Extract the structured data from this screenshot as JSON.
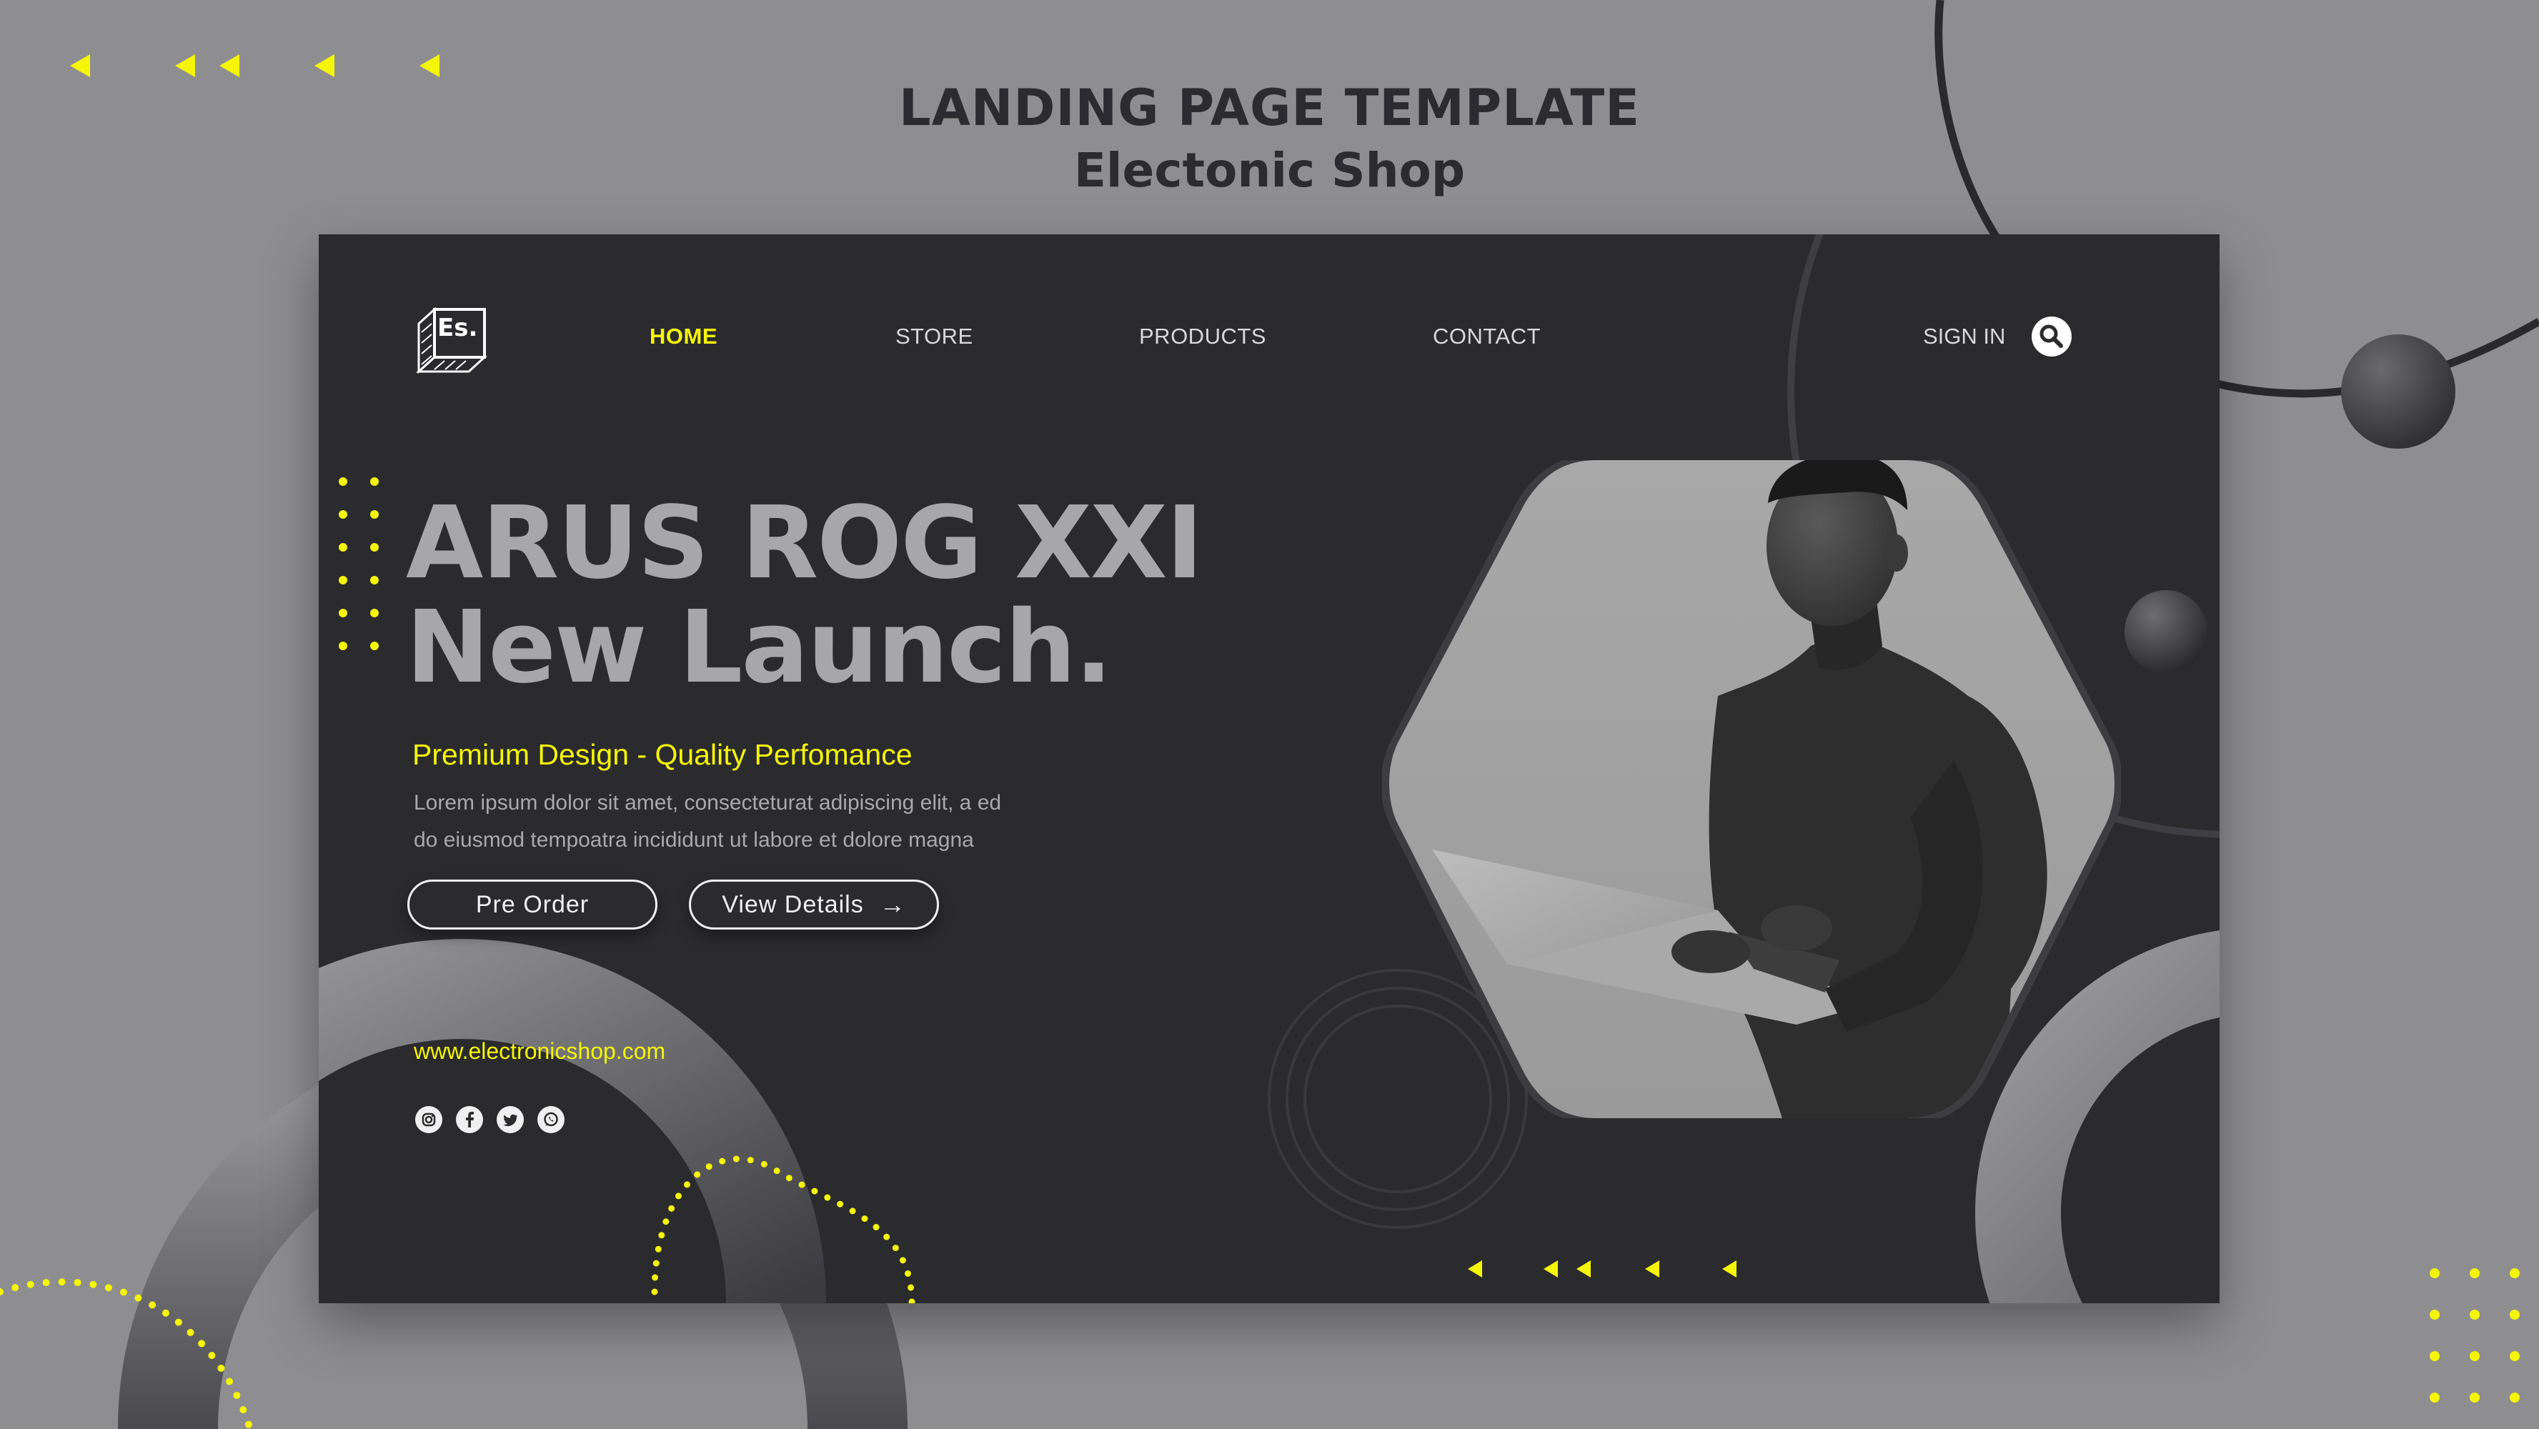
{
  "page": {
    "title": "LANDING PAGE TEMPLATE",
    "subtitle": "Electonic Shop"
  },
  "header": {
    "logo_text": "Es.",
    "nav": [
      {
        "label": "HOME",
        "active": true
      },
      {
        "label": "STORE",
        "active": false
      },
      {
        "label": "PRODUCTS",
        "active": false
      },
      {
        "label": "CONTACT",
        "active": false
      }
    ],
    "sign_in": "SIGN IN",
    "search_icon": "search-icon"
  },
  "hero": {
    "headline_line1": "ARUS ROG XXI",
    "headline_line2": "New Launch.",
    "tagline": "Premium Design - Quality Perfomance",
    "body_line1": "Lorem ipsum dolor sit amet, consecteturat adipiscing elit, a ed",
    "body_line2": "do eiusmod tempoatra incididunt ut labore et dolore magna",
    "buttons": {
      "pre_order": "Pre Order",
      "view_details": "View Details"
    },
    "image": "man-holding-laptop-photo"
  },
  "footer": {
    "website": "www.electronicshop.com",
    "social_icons": [
      "instagram-icon",
      "facebook-icon",
      "twitter-icon",
      "whatsapp-icon"
    ]
  },
  "colors": {
    "accent": "#f5f50a",
    "background": "#8e8e90",
    "card": "#2b2b2e",
    "headline": "#a7a7a9"
  }
}
